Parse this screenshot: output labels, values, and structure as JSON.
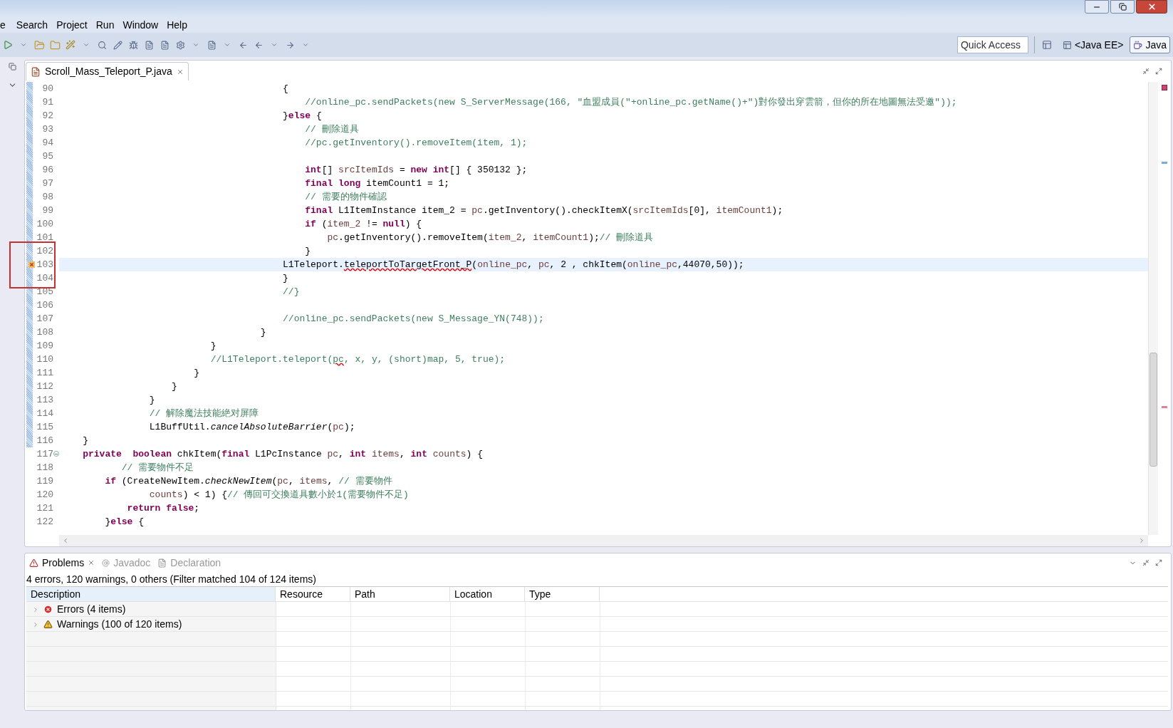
{
  "menu": [
    {
      "label": "e"
    },
    {
      "label": "Search"
    },
    {
      "label": "Project"
    },
    {
      "label": "Run"
    },
    {
      "label": "Window"
    },
    {
      "label": "Help"
    }
  ],
  "toolbar": {
    "quick_access": {
      "placeholder": "Quick Access"
    },
    "perspectives": [
      {
        "label": "<Java EE>",
        "selected": false
      },
      {
        "label": "Java",
        "selected": true
      }
    ]
  },
  "editor": {
    "tab": {
      "title": "Scroll_Mass_Teleport_P.java"
    },
    "lines": [
      {
        "number": "90",
        "changed": true,
        "current": false,
        "tokens": [
          {
            "kind": "code",
            "text": "                                        {"
          }
        ]
      },
      {
        "number": "91",
        "changed": true,
        "current": false,
        "tokens": [
          {
            "kind": "comment",
            "text": "                                            //online_pc.sendPackets(new S_ServerMessage(166, \"血盟成員(\"+online_pc.getName()+\")對你發出穿雲箭，但你的所在地圖無法受邀\"));"
          }
        ]
      },
      {
        "number": "92",
        "changed": true,
        "current": false,
        "tokens": [
          {
            "kind": "code",
            "text": "                                        }"
          },
          {
            "kind": "kw",
            "text": "else"
          },
          {
            "kind": "code",
            "text": " {"
          }
        ]
      },
      {
        "number": "93",
        "changed": true,
        "current": false,
        "tokens": [
          {
            "kind": "comment",
            "text": "                                            // 刪除道具"
          }
        ]
      },
      {
        "number": "94",
        "changed": true,
        "current": false,
        "tokens": [
          {
            "kind": "comment",
            "text": "                                            //pc.getInventory().removeItem(item, 1);"
          }
        ]
      },
      {
        "number": "95",
        "changed": true,
        "current": false
      },
      {
        "number": "96",
        "changed": true,
        "current": false,
        "tokens": [
          {
            "kind": "kw",
            "text": "                                            int"
          },
          {
            "kind": "code",
            "text": "[] "
          },
          {
            "kind": "var",
            "text": "srcItemIds"
          },
          {
            "kind": "code",
            "text": " = "
          },
          {
            "kind": "kw",
            "text": "new int"
          },
          {
            "kind": "code",
            "text": "[] { 350132 };"
          }
        ]
      },
      {
        "number": "97",
        "changed": true,
        "current": false,
        "tokens": [
          {
            "kind": "kw",
            "text": "                                            final long"
          },
          {
            "kind": "code",
            "text": " itemCount1 = 1;"
          }
        ]
      },
      {
        "number": "98",
        "changed": true,
        "current": false,
        "tokens": [
          {
            "kind": "comment",
            "text": "                                            // 需要的物件確認"
          }
        ]
      },
      {
        "number": "99",
        "changed": true,
        "current": false,
        "tokens": [
          {
            "kind": "kw",
            "text": "                                            final"
          },
          {
            "kind": "code",
            "text": " L1ItemInstance item_2 = "
          },
          {
            "kind": "var",
            "text": "pc"
          },
          {
            "kind": "code",
            "text": ".getInventory().checkItemX("
          },
          {
            "kind": "var",
            "text": "srcItemIds"
          },
          {
            "kind": "code",
            "text": "[0], "
          },
          {
            "kind": "var",
            "text": "itemCount1"
          },
          {
            "kind": "code",
            "text": ");"
          }
        ]
      },
      {
        "number": "100",
        "changed": true,
        "current": false,
        "tokens": [
          {
            "kind": "kw",
            "text": "                                            if"
          },
          {
            "kind": "code",
            "text": " ("
          },
          {
            "kind": "var",
            "text": "item_2"
          },
          {
            "kind": "code",
            "text": " != "
          },
          {
            "kind": "kw",
            "text": "null"
          },
          {
            "kind": "code",
            "text": ") {"
          }
        ]
      },
      {
        "number": "101",
        "changed": true,
        "current": false,
        "tokens": [
          {
            "kind": "var",
            "text": "                                                pc"
          },
          {
            "kind": "code",
            "text": ".getInventory().removeItem("
          },
          {
            "kind": "var",
            "text": "item_2"
          },
          {
            "kind": "code",
            "text": ", "
          },
          {
            "kind": "var",
            "text": "itemCount1"
          },
          {
            "kind": "code",
            "text": ");"
          },
          {
            "kind": "comment",
            "text": "// 刪除道具"
          }
        ]
      },
      {
        "number": "102",
        "changed": true,
        "current": false,
        "tokens": [
          {
            "kind": "code",
            "text": "                                            }"
          }
        ]
      },
      {
        "number": "103",
        "changed": true,
        "current": true,
        "error": true,
        "tokens": [
          {
            "kind": "code",
            "text": "                                        L1Teleport."
          },
          {
            "kind": "error",
            "text": "teleportToTargetFront_P"
          },
          {
            "kind": "code",
            "text": "("
          },
          {
            "kind": "var",
            "text": "online_pc"
          },
          {
            "kind": "code",
            "text": ", "
          },
          {
            "kind": "var",
            "text": "pc"
          },
          {
            "kind": "code",
            "text": ", 2 , chkItem("
          },
          {
            "kind": "var",
            "text": "online_pc"
          },
          {
            "kind": "code",
            "text": ",44070,50));"
          }
        ]
      },
      {
        "number": "104",
        "changed": true,
        "current": false,
        "tokens": [
          {
            "kind": "code",
            "text": "                                        }"
          }
        ]
      },
      {
        "number": "105",
        "changed": true,
        "current": false,
        "tokens": [
          {
            "kind": "comment",
            "text": "                                        //}"
          }
        ]
      },
      {
        "number": "106",
        "changed": true,
        "current": false
      },
      {
        "number": "107",
        "changed": true,
        "current": false,
        "tokens": [
          {
            "kind": "comment",
            "text": "                                        //online_pc.sendPackets(new S_Message_YN(748));"
          }
        ]
      },
      {
        "number": "108",
        "changed": true,
        "current": false,
        "tokens": [
          {
            "kind": "code",
            "text": "                                    }"
          }
        ]
      },
      {
        "number": "109",
        "changed": true,
        "current": false,
        "tokens": [
          {
            "kind": "code",
            "text": "                           }"
          }
        ]
      },
      {
        "number": "110",
        "changed": true,
        "current": false,
        "tokens": [
          {
            "kind": "comment",
            "text": "                           //L1Teleport.teleport("
          },
          {
            "kind": "comment_flagged",
            "text": "pc"
          },
          {
            "kind": "comment",
            "text": ", x, y, (short)map, 5, true);"
          }
        ]
      },
      {
        "number": "111",
        "changed": true,
        "current": false,
        "tokens": [
          {
            "kind": "code",
            "text": "                        }"
          }
        ]
      },
      {
        "number": "112",
        "changed": true,
        "current": false,
        "tokens": [
          {
            "kind": "code",
            "text": "                    }"
          }
        ]
      },
      {
        "number": "113",
        "changed": true,
        "current": false,
        "tokens": [
          {
            "kind": "code",
            "text": "                }"
          }
        ]
      },
      {
        "number": "114",
        "changed": true,
        "current": false,
        "tokens": [
          {
            "kind": "comment",
            "text": "                // 解除魔法技能絶对屏障"
          }
        ]
      },
      {
        "number": "115",
        "changed": true,
        "current": false,
        "tokens": [
          {
            "kind": "code",
            "text": "                L1BuffUtil."
          },
          {
            "kind": "static",
            "text": "cancelAbsoluteBarrier"
          },
          {
            "kind": "code",
            "text": "("
          },
          {
            "kind": "var",
            "text": "pc"
          },
          {
            "kind": "code",
            "text": ");"
          }
        ]
      },
      {
        "number": "116",
        "changed": true,
        "current": false,
        "tokens": [
          {
            "kind": "code",
            "text": "    }"
          }
        ]
      },
      {
        "number": "117",
        "changed": false,
        "current": false,
        "foldable": true,
        "tokens": [
          {
            "kind": "kw",
            "text": "    private  boolean"
          },
          {
            "kind": "code",
            "text": " chkItem("
          },
          {
            "kind": "kw",
            "text": "final"
          },
          {
            "kind": "code",
            "text": " L1PcInstance "
          },
          {
            "kind": "var",
            "text": "pc"
          },
          {
            "kind": "code",
            "text": ", "
          },
          {
            "kind": "kw",
            "text": "int"
          },
          {
            "kind": "var",
            "text": " items"
          },
          {
            "kind": "code",
            "text": ", "
          },
          {
            "kind": "kw",
            "text": "int"
          },
          {
            "kind": "var",
            "text": " counts"
          },
          {
            "kind": "code",
            "text": ") {"
          }
        ]
      },
      {
        "number": "118",
        "changed": false,
        "current": false,
        "tokens": [
          {
            "kind": "comment",
            "text": "           // 需要物件不足"
          }
        ]
      },
      {
        "number": "119",
        "changed": false,
        "current": false,
        "tokens": [
          {
            "kind": "kw",
            "text": "        if"
          },
          {
            "kind": "code",
            "text": " (CreateNewItem."
          },
          {
            "kind": "static",
            "text": "checkNewItem"
          },
          {
            "kind": "code",
            "text": "("
          },
          {
            "kind": "var",
            "text": "pc"
          },
          {
            "kind": "code",
            "text": ", "
          },
          {
            "kind": "var",
            "text": "items"
          },
          {
            "kind": "code",
            "text": ", "
          },
          {
            "kind": "comment",
            "text": "// 需要物件"
          }
        ]
      },
      {
        "number": "120",
        "changed": false,
        "current": false,
        "tokens": [
          {
            "kind": "var",
            "text": "                counts"
          },
          {
            "kind": "code",
            "text": ") < 1) {"
          },
          {
            "kind": "comment",
            "text": "// 傳回可交換道具數小於1(需要物件不足)"
          }
        ]
      },
      {
        "number": "121",
        "changed": false,
        "current": false,
        "tokens": [
          {
            "kind": "kw",
            "text": "            return false"
          },
          {
            "kind": "code",
            "text": ";"
          }
        ]
      },
      {
        "number": "122",
        "changed": false,
        "current": false,
        "tokens": [
          {
            "kind": "code",
            "text": "        }"
          },
          {
            "kind": "kw",
            "text": "else"
          },
          {
            "kind": "code",
            "text": " {"
          }
        ]
      }
    ]
  },
  "problems": {
    "tabs": [
      {
        "label": "Problems",
        "selected": true
      },
      {
        "label": "Javadoc",
        "selected": false
      },
      {
        "label": "Declaration",
        "selected": false
      }
    ],
    "summary": "4 errors, 120 warnings, 0 others (Filter matched 104 of 124 items)",
    "columns": [
      "Description",
      "Resource",
      "Path",
      "Location",
      "Type"
    ],
    "rows": [
      {
        "kind": "error",
        "label": "Errors (4 items)",
        "expanded": false
      },
      {
        "kind": "warning",
        "label": "Warnings (100 of 120 items)",
        "expanded": false
      }
    ]
  }
}
